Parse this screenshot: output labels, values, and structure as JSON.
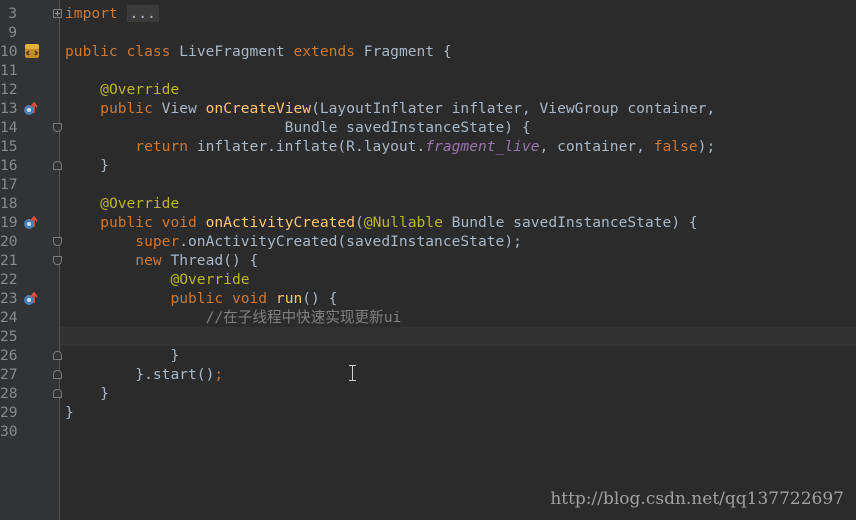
{
  "editor": {
    "line_numbers": [
      "3",
      "9",
      "10",
      "11",
      "12",
      "13",
      "14",
      "15",
      "16",
      "17",
      "18",
      "19",
      "20",
      "21",
      "22",
      "23",
      "24",
      "25",
      "26",
      "27",
      "28",
      "29",
      "30"
    ],
    "lines": {
      "l3_import": "import",
      "l3_folded": "...",
      "l10_public": "public",
      "l10_class": "class",
      "l10_name": "LiveFragment",
      "l10_extends": "extends",
      "l10_rest": "Fragment {",
      "l12_override": "@Override",
      "l13_public": "public",
      "l13_type": "View",
      "l13_method": "onCreateView",
      "l13_rest": "(LayoutInflater inflater, ViewGroup container,",
      "l14_rest": "Bundle savedInstanceState) {",
      "l15_return": "return",
      "l15_mid": "inflater.inflate(R.layout.",
      "l15_field": "fragment_live",
      "l15_mid2": ", container, ",
      "l15_false": "false",
      "l15_end": ");",
      "l16_close": "}",
      "l18_override": "@Override",
      "l19_public": "public",
      "l19_void": "void",
      "l19_method": "onActivityCreated",
      "l19_paren": "(",
      "l19_nullable": "@Nullable",
      "l19_rest": "Bundle savedInstanceState) {",
      "l20_super": "super",
      "l20_rest": ".onActivityCreated(savedInstanceState);",
      "l21_new": "new",
      "l21_rest": "Thread() {",
      "l22_override": "@Override",
      "l23_public": "public",
      "l23_void": "void",
      "l23_method": "run",
      "l23_rest": "() {",
      "l24_comment": "//在子线程中快速实现更新ui",
      "l26_close": "}",
      "l27_close": "}.start()",
      "l27_semi": ";",
      "l28_close": "}",
      "l29_close": "}"
    }
  },
  "watermark": "http://blog.csdn.net/qq137722697",
  "colors": {
    "background": "#2b2b2b",
    "keyword": "#cc7832",
    "annotation": "#bbb529",
    "method": "#ffc66d",
    "field": "#9876aa",
    "comment": "#808080",
    "text": "#a9b7c6"
  }
}
